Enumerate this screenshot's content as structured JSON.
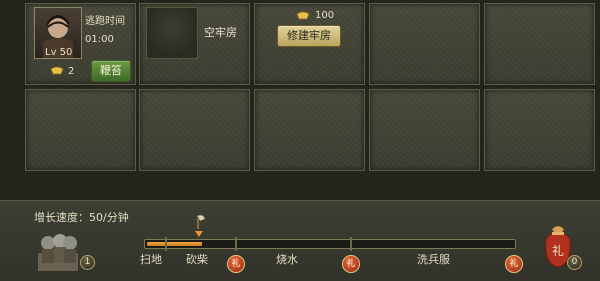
{
  "prisoner": {
    "escape_label": "逃跑时间",
    "escape_time": "01:00",
    "level": "Lv 50",
    "cost": "2",
    "action_label": "鞭笞"
  },
  "empty_cell": {
    "label": "空牢房"
  },
  "build": {
    "cost": "100",
    "button_label": "修建牢房"
  },
  "growth": {
    "speed_text": "增长速度：50/分钟",
    "progress": 0.15
  },
  "stages": [
    "扫地",
    "砍柴",
    "烧水",
    "洗兵服"
  ],
  "gift_glyph": "礼",
  "soldiers_count": "1",
  "gift_count": "0",
  "colors": {
    "progress": "#e8952f",
    "gold": "#e5c14a",
    "green_button": "#5a8436",
    "gold_button": "#d1c07a"
  }
}
